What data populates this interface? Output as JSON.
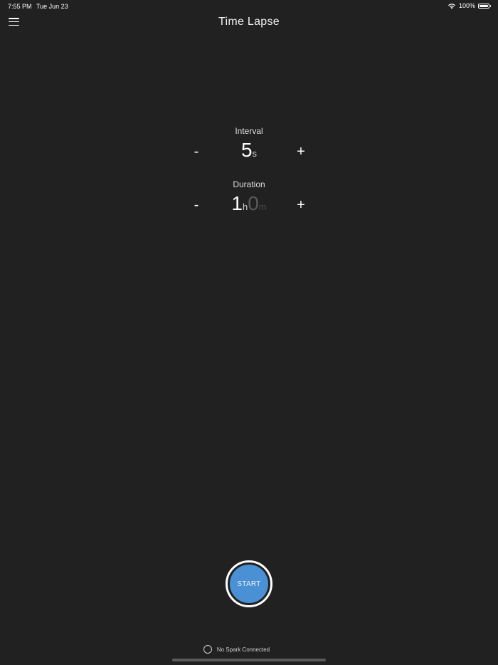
{
  "status_bar": {
    "time": "7:55 PM",
    "date": "Tue Jun 23",
    "battery": "100%",
    "wifi_icon": "wifi-icon",
    "battery_icon": "battery-icon"
  },
  "header": {
    "menu_icon": "hamburger-menu-icon",
    "title": "Time Lapse"
  },
  "interval": {
    "label": "Interval",
    "minus": "-",
    "plus": "+",
    "value": "5",
    "unit": "s"
  },
  "duration": {
    "label": "Duration",
    "minus": "-",
    "plus": "+",
    "hours_value": "1",
    "hours_unit": "h",
    "minutes_value": "0",
    "minutes_unit": "m"
  },
  "start_button": {
    "label": "START",
    "color": "#4a90d4"
  },
  "footer": {
    "connection_status": "No Spark Connected"
  },
  "colors": {
    "background": "#212121",
    "accent": "#4a90d4"
  }
}
